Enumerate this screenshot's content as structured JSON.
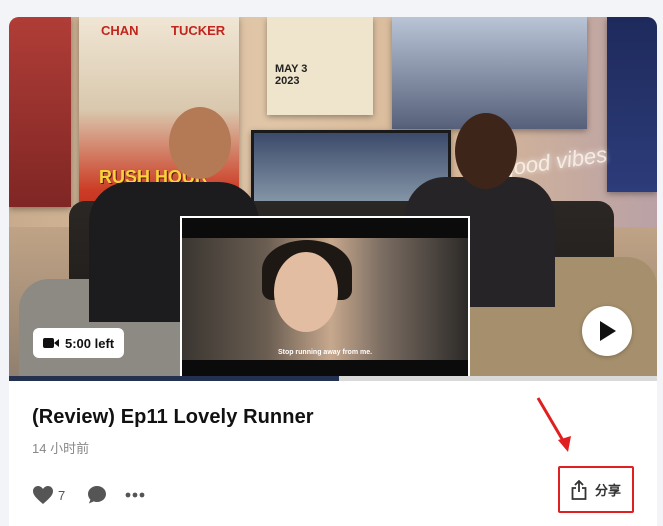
{
  "video": {
    "time_left": "5:00 left",
    "subtitle": "Stop running away from me.",
    "watched_fraction": 0.51,
    "poster_name_1": "CHAN",
    "poster_name_2": "TUCKER",
    "poster_title": "RUSH HOUR",
    "event_date": "MAY 3\n2023",
    "neon_sign": "good vibes"
  },
  "post": {
    "title": "(Review) Ep11 Lovely Runner",
    "timestamp": "14 小时前",
    "like_count": "7"
  },
  "actions": {
    "share_label": "分享"
  },
  "colors": {
    "highlight": "#e02020",
    "progress": "#24304f"
  }
}
